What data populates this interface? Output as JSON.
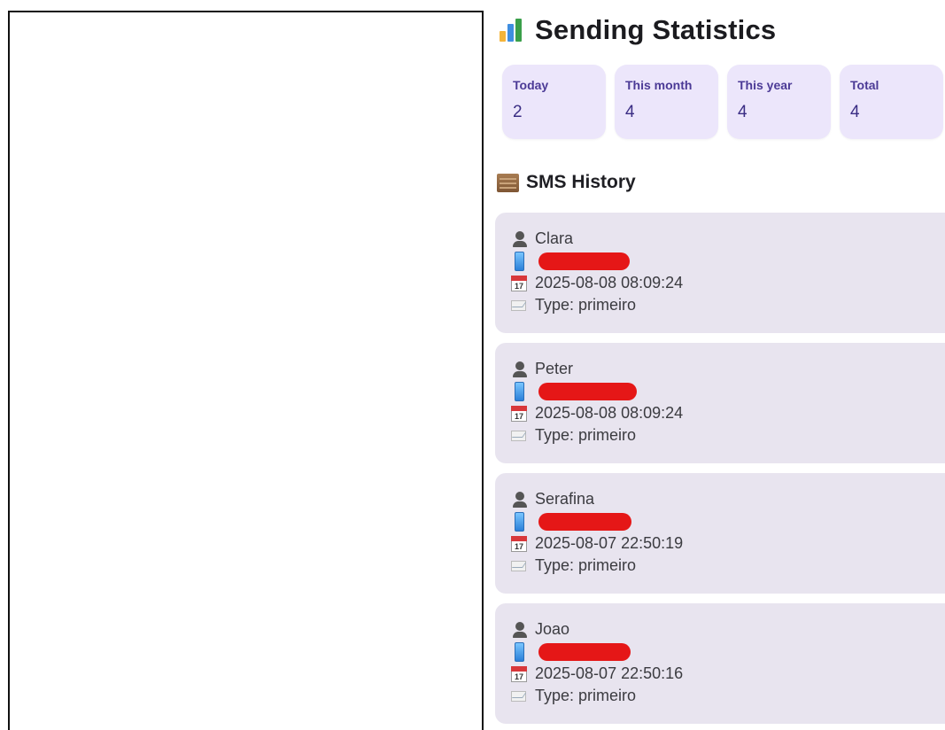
{
  "stats_title": "Sending Statistics",
  "stats": [
    {
      "label": "Today",
      "value": "2"
    },
    {
      "label": "This month",
      "value": "4"
    },
    {
      "label": "This year",
      "value": "4"
    },
    {
      "label": "Total",
      "value": "4"
    }
  ],
  "history_title": "SMS History",
  "history": [
    {
      "name": "Clara",
      "datetime": "2025-08-08 08:09:24",
      "type": "Type: primeiro"
    },
    {
      "name": "Peter",
      "datetime": "2025-08-08 08:09:24",
      "type": "Type: primeiro"
    },
    {
      "name": "Serafina",
      "datetime": "2025-08-07 22:50:19",
      "type": "Type: primeiro"
    },
    {
      "name": "Joao",
      "datetime": "2025-08-07 22:50:16",
      "type": "Type: primeiro"
    }
  ],
  "icons": {
    "stats": "bar-chart-icon",
    "history": "scroll-icon",
    "contact": "person-icon",
    "phone": "phone-icon",
    "date": "calendar-icon",
    "type": "mail-icon"
  },
  "colors": {
    "card_background": "#ece6fb",
    "stat_text": "#3a2d84",
    "entry_background": "#e8e4ef",
    "redaction": "#e51717"
  }
}
